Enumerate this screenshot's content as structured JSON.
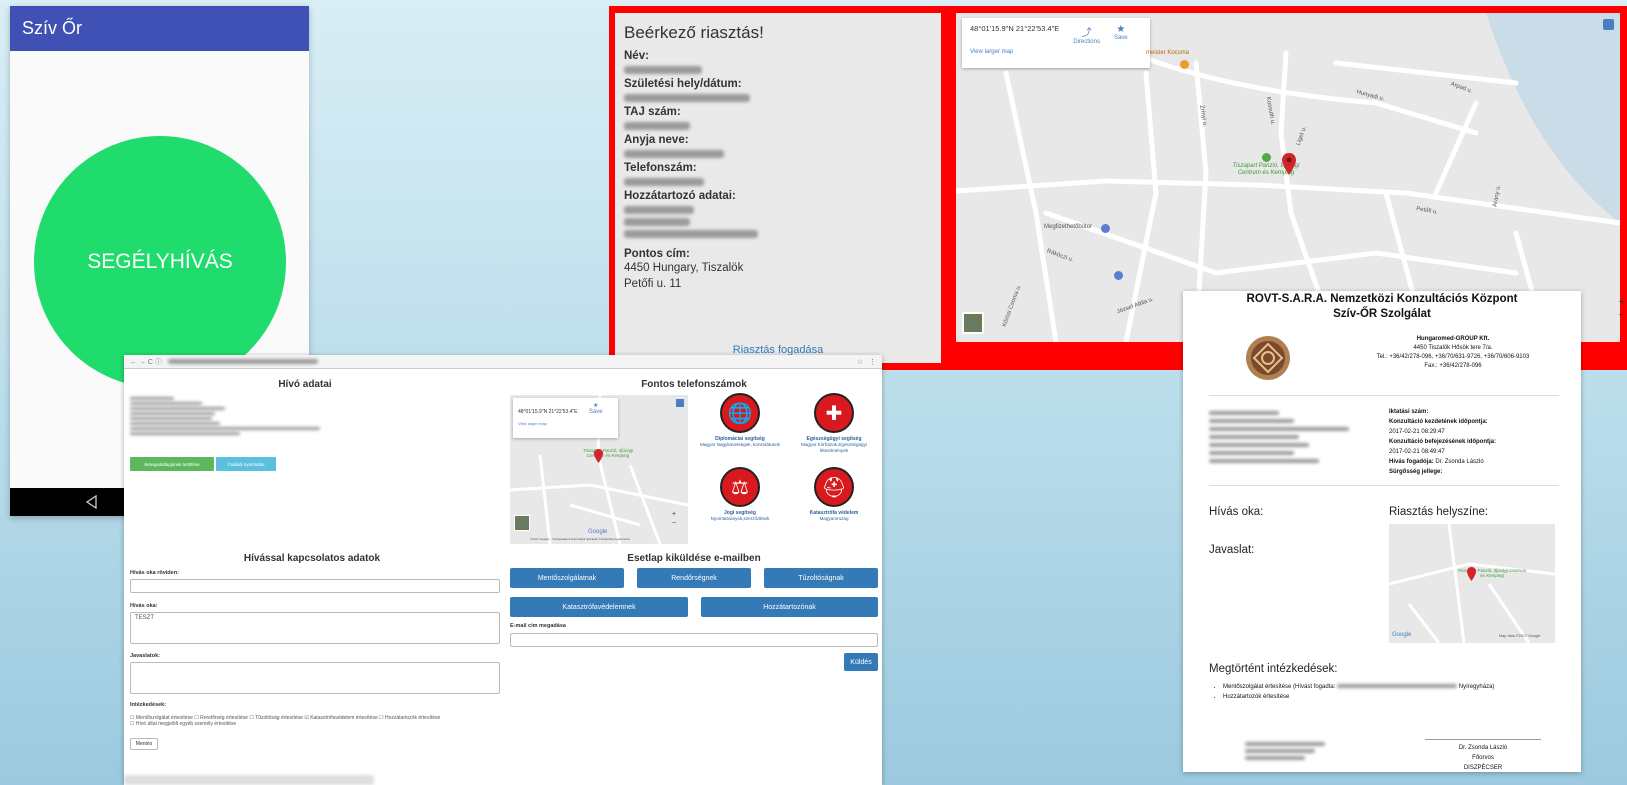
{
  "phone": {
    "app_title": "Szív Őr",
    "emergency_button": "SEGÉLYHÍVÁS"
  },
  "alarm": {
    "heading": "Beérkező riasztás!",
    "labels": {
      "name": "Név:",
      "birth": "Születési hely/dátum:",
      "taj": "TAJ szám:",
      "mother": "Anyja neve:",
      "phone": "Telefonszám:",
      "relatives": "Hozzátartozó adatai:",
      "address": "Pontos cím:"
    },
    "address_line1": "4450 Hungary, Tiszalök",
    "address_line2": "Petőfi u. 11",
    "accept_link": "Riasztás fogadása",
    "map": {
      "coords": "48°01'15.9\"N 21°22'53.4\"E",
      "directions": "Directions",
      "save": "Save",
      "larger_map": "View larger map",
      "pois": {
        "kocsma": "meister Kocsma",
        "panzio": "Tiszapart Panzió, Ifjúsági Centrum és Kemping",
        "megfizet": "Megfizethetőbútor"
      },
      "streets": [
        "Arpad u.",
        "Hunyadi u.",
        "Kossuth u.",
        "Zrínyi u.",
        "Liget u.",
        "Petőfi u.",
        "Arany u.",
        "Rákóczi u.",
        "József Attila u.",
        "Kőrösi Csoma u."
      ],
      "zoom_in": "+",
      "zoom_out": "−",
      "terms": "Jelentés a térkép hibáiról"
    }
  },
  "dispatcher": {
    "url_icons": "← → C ⓘ",
    "caller_title": "Hívó adatai",
    "btn_green": "Betegadatlapjának letöltése",
    "btn_blue": "Családi nyomtatás",
    "phones_title": "Fontos telefonszámok",
    "map": {
      "coords": "48°01'15.9\"N 21°22'53.4\"E",
      "save": "Save",
      "larger_map": "View larger map",
      "poi": "Tiszapart Panzió, Ifjúsági Centrum és Kemping",
      "brand": "Google",
      "zoom_in": "+",
      "zoom_out": "−",
      "footer": "©2017 Google - Térképadatok  Használati feltételek  Térképhiba bejelentése"
    },
    "services": [
      {
        "title": "Diplomáciai segítség",
        "sub": "Magyar Nagykövetségek, konzulátusok",
        "icon": "globe-icon",
        "glyph": "🌐"
      },
      {
        "title": "Egészségügyi segítség",
        "sub": "Magyar Kórházak,Egészségügyi létesítmények",
        "icon": "medical-cross-icon",
        "glyph": "✚"
      },
      {
        "title": "Jogi segítség",
        "sub": "Nyomtatványok,szerződések",
        "icon": "scales-icon",
        "glyph": "⚖"
      },
      {
        "title": "Katasztrófa védelem",
        "sub": "Magyarország",
        "icon": "disaster-shield-icon",
        "glyph": "⛑"
      }
    ],
    "call_title": "Hívással kapcsolatos adatok",
    "reason_short_label": "Hívás oka röviden:",
    "reason_label": "Hívás oka:",
    "reason_value": "TESZT",
    "suggestions_label": "Javaslatok:",
    "actions_label": "Intézkedések:",
    "checkboxes": [
      {
        "label": "Mentőszolgálat értesítése",
        "checked": false
      },
      {
        "label": "Rendőrség értesítése",
        "checked": false
      },
      {
        "label": "Tűzoltóság értesítése",
        "checked": false
      },
      {
        "label": "Katasztrófavédelem értesítése",
        "checked": true
      },
      {
        "label": "Hozzátartozók értesítése",
        "checked": false
      },
      {
        "label": "Hívó által megjelölt egyéb személy értesítése",
        "checked": false
      }
    ],
    "save_button": "Mentés",
    "email_title": "Esetlap kiküldése e-mailben",
    "email_buttons": [
      "Mentőszolgálatnak",
      "Rendőrségnek",
      "Tűzoltóságnak",
      "Katasztrófavédelemnek",
      "Hozzátartozónak"
    ],
    "email_label": "E-mail cím megadása",
    "send_button": "Küldés"
  },
  "report": {
    "title_line1": "ROVT-S.A.R.A. Nemzetközi Konzultációs Központ",
    "title_line2": "Szív-ŐR Szolgálat",
    "company": "Hungaromed-GROUP Kft.",
    "company_address": "4450 Tiszalök Hősök tere 7/a.",
    "company_tel": "Tel.: +36/42/278-096, +36/70/631-9726, +36/70/606-9103",
    "company_fax": "Fax.: +36/42/278-096",
    "iktatasi": "Iktatási szám:",
    "start_label": "Konzultáció kezdetének időpontja:",
    "start_value": "2017-02-21 08:29:47",
    "end_label": "Konzultáció befejezésének időpontja:",
    "end_value": "2017-02-21 08:49:47",
    "receiver_label": "Hívás fogadója:",
    "receiver_value": "Dr. Zsonda László",
    "urgency_label": "Sürgősség jellege:",
    "call_reason": "Hívás oka:",
    "alarm_location": "Riasztás helyszíne:",
    "suggestion": "Javaslat:",
    "map_poi": "Tiszapart Panzió, Ifjúsági Centrum és Kemping",
    "map_brand": "Google",
    "map_data": "Map data ©2017 Google",
    "measures_title": "Megtörtént intézkedések:",
    "measure1": "Mentőszolgálat értesítése (Hívást fogadta:",
    "measure1_end": "Nyíregyháza)",
    "measure2": "Hozzátartozók értesítése",
    "sign_name": "Dr. Zsonda László",
    "sign_title": "Főorvos",
    "sign_role": "DISZPÉCSER"
  }
}
